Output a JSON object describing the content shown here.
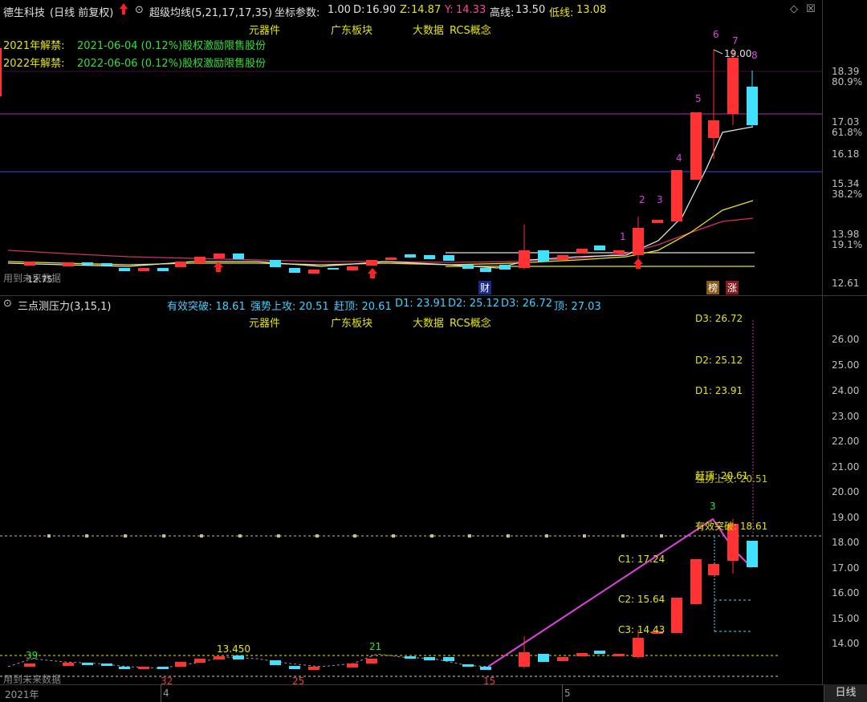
{
  "header": {
    "stock": "德生科技",
    "mode": "(日线 前复权)",
    "indicator": "超级均线(5,21,17,17,35)",
    "coord_label": "坐标参数:",
    "coord_value": "1.00",
    "d_label": "D:",
    "d_value": "16.90",
    "z_label": "Z:",
    "z_value": "14.87",
    "y_label": "Y:",
    "y_value": "14.33",
    "high_label": "高线:",
    "high_value": "13.50",
    "low_label": "低线:",
    "low_value": "13.08"
  },
  "concepts": [
    "元器件",
    "广东板块",
    "大数据",
    "RCS概念"
  ],
  "unlocks": [
    {
      "label": "2021年解禁:",
      "text": "2021-06-04 (0.12%)股权激励限售股份"
    },
    {
      "label": "2022年解禁:",
      "text": "2022-06-06 (0.12%)股权激励限售股份"
    }
  ],
  "top_axis": {
    "ticks": [
      "18.39",
      "17.03",
      "16.18",
      "15.34",
      "13.98",
      "12.61"
    ],
    "pcts": [
      "80.9%",
      "61.8%",
      "38.2%",
      "19.1%"
    ]
  },
  "top_labels": {
    "future_data": "用到未来数据",
    "low_price": "12.75",
    "high_price": "19.00",
    "tag_cai": "财",
    "tag_bang": "榜",
    "tag_zhang": "涨",
    "counts": [
      "1",
      "2",
      "3",
      "4",
      "5",
      "6",
      "7",
      "8"
    ]
  },
  "bottom_header": {
    "indicator": "三点测压力(3,15,1)",
    "valid": "有效突破: 18.61",
    "strong": "强势上攻: 20.51",
    "top_over": "赶顶: 20.61",
    "d1": "D1: 23.91",
    "d2": "D2: 25.12",
    "d3": "D3: 26.72",
    "peak": "顶: 27.03"
  },
  "bottom_axis": {
    "ticks": [
      "26.00",
      "25.00",
      "24.00",
      "23.00",
      "22.00",
      "21.00",
      "20.00",
      "19.00",
      "18.00",
      "17.00",
      "16.00",
      "15.00",
      "14.00"
    ]
  },
  "bottom_labels": {
    "d3": "D3: 26.72",
    "d2": "D2: 25.12",
    "d1": "D1: 23.91",
    "over": "赶顶: 20.61",
    "strong": "强势上攻: 20.51",
    "valid": "有效突破: 18.61",
    "c1": "C1: 17.24",
    "c2": "C2: 15.64",
    "c3": "C3: 14.43",
    "n39": "39",
    "n21": "21",
    "n3": "3",
    "n32": "32",
    "n25": "25",
    "n15": "15",
    "level": "13.450",
    "future_data": "用到未来数据"
  },
  "time_axis": {
    "year": "2021年",
    "m4": "4",
    "m5": "5",
    "period_button": "日线"
  },
  "colors": {
    "up": "#ff3333",
    "down": "#40e0ff",
    "concept": "#e6e600",
    "legend": "#3fd0ff",
    "magenta": "#e040e0"
  }
}
